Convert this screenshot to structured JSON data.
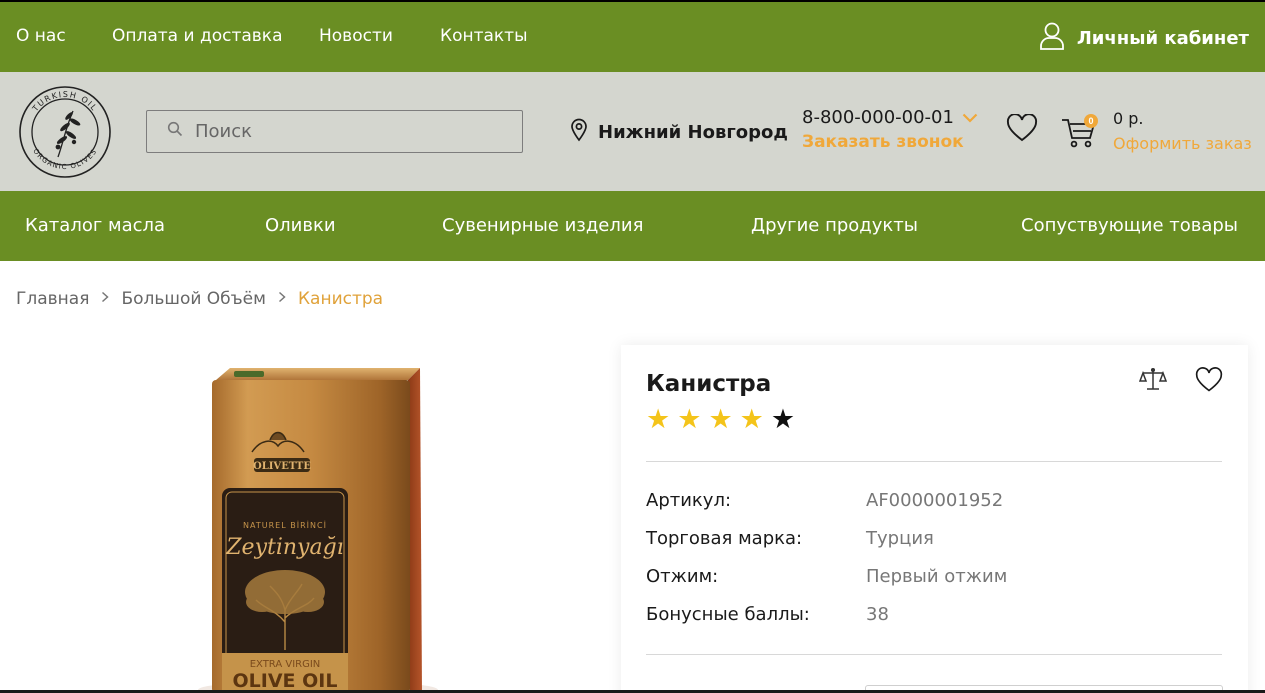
{
  "topbar": {
    "links": [
      "О нас",
      "Оплата и доставка",
      "Новости",
      "Контакты"
    ],
    "cabinet_label": "Личный кабинет"
  },
  "header": {
    "logo_text_top": "TURKISH OIL",
    "logo_text_bottom": "ORGANIC OLIVES",
    "search_placeholder": "Поиск",
    "city": "Нижний Новгород",
    "phone": "8-800-000-00-01",
    "callback_label": "Заказать звонок",
    "cart_count": "0",
    "cart_sum": "0 р.",
    "order_label": "Оформить заказ"
  },
  "catalog_nav": [
    "Каталог масла",
    "Оливки",
    "Сувенирные изделия",
    "Другие продукты",
    "Сопуствующие товары"
  ],
  "breadcrumb": {
    "items": [
      "Главная",
      "Большой Объём"
    ],
    "current": "Канистра"
  },
  "product": {
    "title": "Канистра",
    "rating": 4,
    "rating_max": 5,
    "label_brand": "OLIVETTE",
    "label_sub": "NATUREL BİRİNCİ",
    "label_name": "Zeytinyağı",
    "label_extra": "EXTRA VIRGIN",
    "label_oil": "OLIVE OIL",
    "props": [
      {
        "key": "Артикул:",
        "value": "AF0000001952"
      },
      {
        "key": "Торговая марка:",
        "value": "Турция"
      },
      {
        "key": "Отжим:",
        "value": "Первый отжим"
      },
      {
        "key": "Бонусные баллы:",
        "value": "38"
      }
    ]
  },
  "colors": {
    "green": "#6a8e23",
    "header_bg": "#d4d6cf",
    "accent": "#f0a83a",
    "star": "#f4c41a"
  },
  "icons": [
    "user-icon",
    "search-icon",
    "location-pin-icon",
    "chevron-down-icon",
    "heart-icon",
    "cart-icon",
    "compare-scales-icon",
    "chevron-right-icon",
    "star-icon"
  ]
}
